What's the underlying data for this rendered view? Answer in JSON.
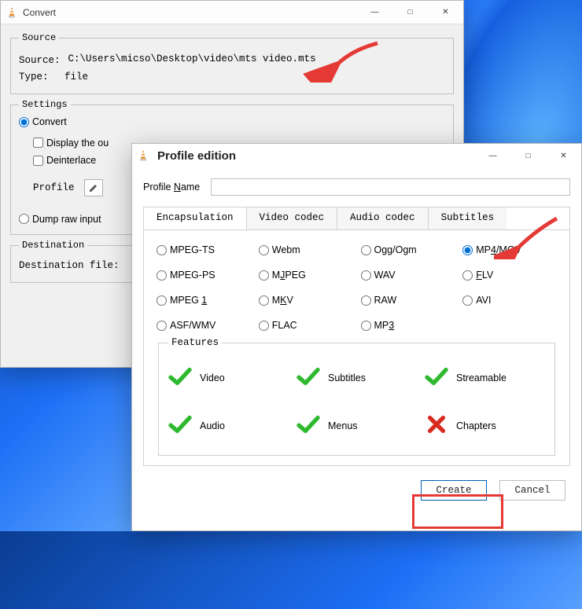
{
  "convert": {
    "title": "Convert",
    "winbtns": {
      "min": "—",
      "max": "□",
      "close": "✕"
    },
    "source_legend": "Source",
    "source_label": "Source:",
    "source_value": "C:\\Users\\micso\\Desktop\\video\\mts video.mts",
    "type_label": "Type:",
    "type_value": "file",
    "settings_legend": "Settings",
    "convert_radio": "Convert",
    "display_chk": "Display the ou",
    "deinterlace_chk": "Deinterlace",
    "profile_label": "Profile",
    "dump_radio": "Dump raw input",
    "destination_legend": "Destination",
    "destination_label": "Destination file:"
  },
  "profile": {
    "title": "Profile edition",
    "winbtns": {
      "min": "—",
      "max": "□",
      "close": "✕"
    },
    "name_label_pre": "Profile ",
    "name_label_ul": "N",
    "name_label_post": "ame",
    "name_value": "",
    "tabs": [
      "Encapsulation",
      "Video codec",
      "Audio codec",
      "Subtitles"
    ],
    "formats": [
      {
        "label": "MPEG-TS",
        "checked": false
      },
      {
        "label": "Webm",
        "checked": false
      },
      {
        "label": "Ogg/Ogm",
        "checked": false
      },
      {
        "label": "MP4/MOV",
        "checked": true,
        "ul": "4"
      },
      {
        "label": "MPEG-PS",
        "checked": false
      },
      {
        "label": "MJPEG",
        "checked": false,
        "ul": "J"
      },
      {
        "label": "WAV",
        "checked": false
      },
      {
        "label": "FLV",
        "checked": false,
        "ul": "F"
      },
      {
        "label": "MPEG 1",
        "checked": false,
        "ul": "1"
      },
      {
        "label": "MKV",
        "checked": false,
        "ul": "K"
      },
      {
        "label": "RAW",
        "checked": false
      },
      {
        "label": "AVI",
        "checked": false
      },
      {
        "label": "ASF/WMV",
        "checked": false
      },
      {
        "label": "FLAC",
        "checked": false
      },
      {
        "label": "MP3",
        "checked": false,
        "ul": "3"
      }
    ],
    "features_legend": "Features",
    "features": [
      {
        "label": "Video",
        "ok": true
      },
      {
        "label": "Subtitles",
        "ok": true
      },
      {
        "label": "Streamable",
        "ok": true
      },
      {
        "label": "Audio",
        "ok": true
      },
      {
        "label": "Menus",
        "ok": true
      },
      {
        "label": "Chapters",
        "ok": false
      }
    ],
    "create_btn": "Create",
    "cancel_btn": "Cancel"
  }
}
